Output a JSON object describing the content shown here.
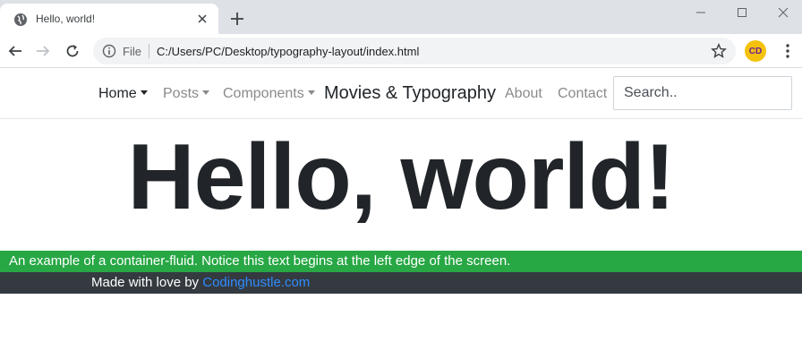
{
  "browser": {
    "tab_title": "Hello, world!",
    "scheme_label": "File",
    "url": "C:/Users/PC/Desktop/typography-layout/index.html",
    "profile_initials": "CD"
  },
  "navbar": {
    "links": [
      {
        "label": "Home",
        "dropdown": true,
        "active": true
      },
      {
        "label": "Posts",
        "dropdown": true,
        "active": false
      },
      {
        "label": "Components",
        "dropdown": true,
        "active": false
      },
      {
        "label": "About",
        "dropdown": false,
        "active": false
      },
      {
        "label": "Contact",
        "dropdown": false,
        "active": false
      }
    ],
    "brand": "Movies & Typography",
    "search_placeholder": "Search.."
  },
  "hero": {
    "heading": "Hello, world!"
  },
  "container_fluid": {
    "text": "An example of a container-fluid. Notice this text begins at the left edge of the screen."
  },
  "footer": {
    "prefix": "Made with love by ",
    "link_text": "Codinghustle.com"
  },
  "colors": {
    "container_bg": "#28a745",
    "footer_bg": "#343a40",
    "link": "#2f8cff",
    "heading": "#212529"
  }
}
